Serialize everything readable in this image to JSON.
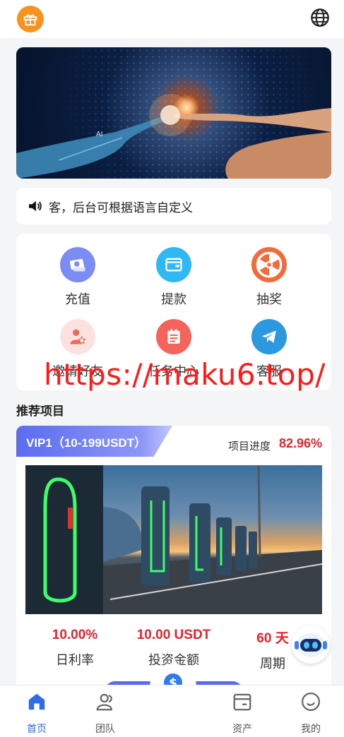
{
  "header": {
    "gift_icon": "gift-icon",
    "globe_icon": "globe-icon"
  },
  "banner": {
    "alt": "AI hands banner",
    "text": "AI"
  },
  "notice": {
    "icon": "speaker-icon",
    "text": "客，后台可根据语言自定义"
  },
  "menu": {
    "items": [
      {
        "label": "充值",
        "icon": "deposit-icon",
        "color": "#7b8df5"
      },
      {
        "label": "提款",
        "icon": "wallet-icon",
        "color": "#2fb8f4"
      },
      {
        "label": "抽奖",
        "icon": "wheel-icon",
        "color": "#f46b3b"
      },
      {
        "label": "邀请好友",
        "icon": "invite-user-icon",
        "color": "#fbe1df"
      },
      {
        "label": "任务中心",
        "icon": "task-list-icon",
        "color": "#f4645a"
      },
      {
        "label": "客服",
        "icon": "telegram-icon",
        "color": "#2b98e0"
      }
    ]
  },
  "watermark": "https://maku6.top/",
  "recommend": {
    "title": "推荐项目",
    "project": {
      "vip": "VIP1（10-199USDT）",
      "progress_label": "项目进度",
      "progress_value": "82.96%",
      "progress": 0.8296,
      "stats": [
        {
          "value": "10.00%",
          "label": "日利率"
        },
        {
          "value": "10.00 USDT",
          "label": "投资金额"
        },
        {
          "value": "60 天",
          "label": "周期"
        }
      ]
    }
  },
  "tabbar": {
    "items": [
      {
        "label": "首页",
        "icon": "home-icon",
        "active": true
      },
      {
        "label": "团队",
        "icon": "team-icon",
        "active": false
      },
      {
        "label": "资产",
        "icon": "assets-icon",
        "active": false
      },
      {
        "label": "我的",
        "icon": "profile-icon",
        "active": false
      }
    ],
    "center_icon": "dollar-hand-icon"
  },
  "colors": {
    "accent": "#2e6de6",
    "red": "#e8232c",
    "vip": "#5b6cf0"
  }
}
